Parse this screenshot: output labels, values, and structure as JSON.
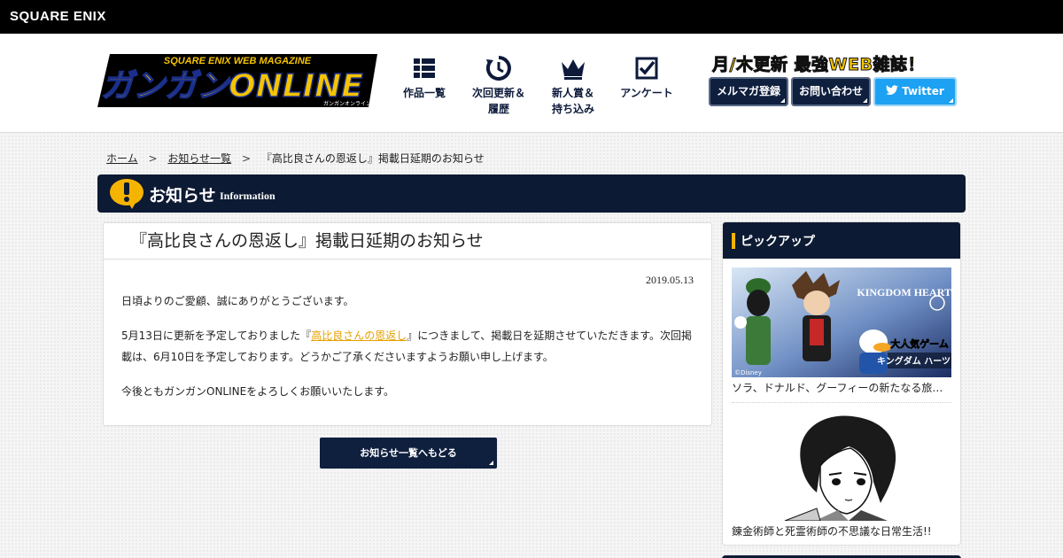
{
  "brand": {
    "logo_text": "SQUARE ENIX"
  },
  "site": {
    "logo_top_text": "SQUARE ENIX WEB MAGAZINE",
    "logo_main_text": "ガンガンONLINE",
    "logo_sub_text": "ガンガンオンライン"
  },
  "nav": [
    {
      "label": "作品一覧",
      "icon": "grid-list-icon"
    },
    {
      "label": "次回更新＆\n履歴",
      "icon": "refresh-clock-icon"
    },
    {
      "label": "新人賞＆\n持ち込み",
      "icon": "crown-icon"
    },
    {
      "label": "アンケート",
      "icon": "checkbox-icon"
    }
  ],
  "header": {
    "tagline": "月/木更新 最強WEB雑誌！",
    "mailmag_label": "メルマガ登録",
    "contact_label": "お問い合わせ",
    "twitter_label": "Twitter"
  },
  "breadcrumb": {
    "home": "ホーム",
    "list": "お知らせ一覧",
    "current": "『高比良さんの恩返し』掲載日延期のお知らせ",
    "sep": ">"
  },
  "section": {
    "title": "お知らせ",
    "subtitle": "Information"
  },
  "article": {
    "title": "『高比良さんの恩返し』掲載日延期のお知らせ",
    "date": "2019.05.13",
    "p1": "日頃よりのご愛顧、誠にありがとうございます。",
    "p2_before": "5月13日に更新を予定しておりました『",
    "p2_link": "高比良さんの恩返し",
    "p2_after": "』につきまして、掲載日を延期させていただきます。次回掲載は、6月10日を予定しております。どうかご了承くださいますようお願い申し上げます。",
    "p3": "今後ともガンガンONLINEをよろしくお願いいたします。"
  },
  "back_button": {
    "label": "お知らせ一覧へもどる"
  },
  "pickup": {
    "title": "ピックアップ",
    "items": [
      {
        "caption": "ソラ、ドナルド、グーフィーの新たなる旅…",
        "banner_badge": "大人気ゲーム",
        "banner_title": "キングダム ハーツ Ⅲ",
        "banner_logo": "KINGDOM HEARTS",
        "copyright": "©Disney"
      },
      {
        "caption": "錬金術師と死霊術師の不思議な日常生活!!"
      }
    ]
  },
  "colors": {
    "navy": "#0d1a33",
    "accent_yellow": "#f5b400",
    "link_orange": "#e5a000",
    "twitter_blue": "#1da1f2"
  }
}
